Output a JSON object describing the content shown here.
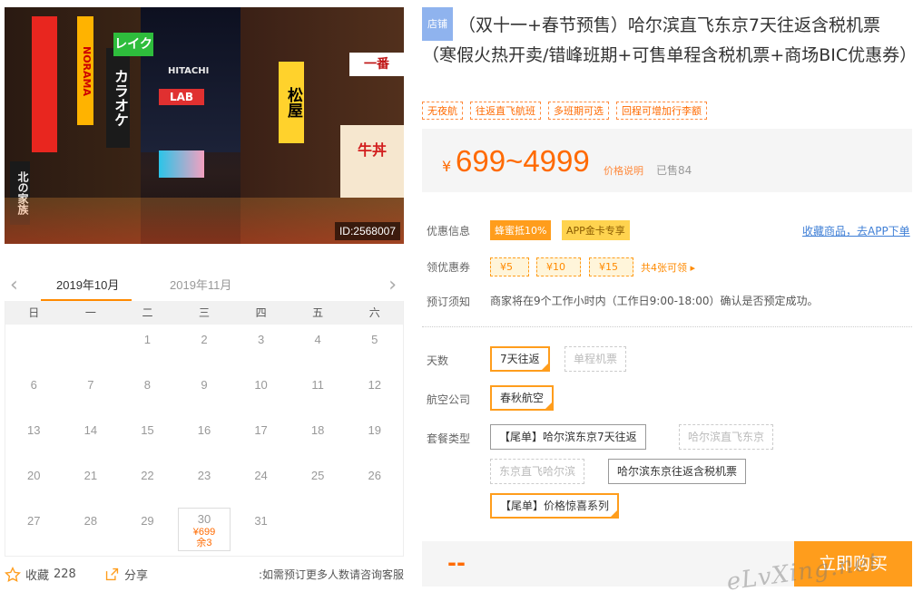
{
  "photo": {
    "id_label": "ID:2568007",
    "signs": [
      "カラオケ",
      "NORAMA",
      "レイク",
      "HITACHI",
      "LAB",
      "松屋",
      "一番",
      "北の家族",
      "牛丼"
    ]
  },
  "calendar": {
    "prev_icon": "chevron-left-icon",
    "next_icon": "chevron-right-icon",
    "months": [
      "2019年10月",
      "2019年11月"
    ],
    "weekdays": [
      "日",
      "一",
      "二",
      "三",
      "四",
      "五",
      "六"
    ],
    "leading_blanks": 2,
    "days": [
      "1",
      "2",
      "3",
      "4",
      "5",
      "6",
      "7",
      "8",
      "9",
      "10",
      "11",
      "12",
      "13",
      "14",
      "15",
      "16",
      "17",
      "18",
      "19",
      "20",
      "21",
      "22",
      "23",
      "24",
      "25",
      "26",
      "27",
      "28",
      "29",
      "30",
      "31"
    ],
    "available": {
      "day": "30",
      "price": "¥699",
      "remaining": "余3"
    }
  },
  "footer": {
    "fav_label": "收藏",
    "fav_count": "228",
    "share_label": "分享",
    "consult_text": ":如需预订更多人数请咨询客服"
  },
  "product": {
    "shop_badge": "店铺",
    "title": "（双十一+春节预售）哈尔滨直飞东京7天往返含税机票（寒假火热开卖/错峰班期+可售单程含税机票+商场BIC优惠券）",
    "tags": [
      "无夜航",
      "往返直飞航班",
      "多班期可选",
      "回程可增加行李额"
    ],
    "price_symbol": "¥",
    "price_range": "699~4999",
    "price_desc": "价格说明",
    "sold": "已售84"
  },
  "offers": {
    "label": "优惠信息",
    "promo1": "蜂蜜抵10%",
    "promo2": "APP金卡专享",
    "fav_app": "收藏商品，去APP下单"
  },
  "coupons": {
    "label": "领优惠券",
    "items": [
      "¥5",
      "¥10",
      "¥15"
    ],
    "more": "共4张可领 ▸"
  },
  "booking": {
    "label": "预订须知",
    "notice": "商家将在9个工作小时内（工作日9:00-18:00）确认是否预定成功。"
  },
  "options": {
    "days_label": "天数",
    "days": [
      {
        "text": "7天往返",
        "state": "selected"
      },
      {
        "text": "单程机票",
        "state": "disabled"
      }
    ],
    "airline_label": "航空公司",
    "airline": [
      {
        "text": "春秋航空",
        "state": "selected"
      }
    ],
    "package_label": "套餐类型",
    "packages": [
      {
        "text": "【尾单】哈尔滨东京7天往返",
        "state": "normal"
      },
      {
        "text": "哈尔滨直飞东京",
        "state": "disabled"
      },
      {
        "text": "东京直飞哈尔滨",
        "state": "disabled"
      },
      {
        "text": "哈尔滨东京往返含税机票",
        "state": "normal"
      },
      {
        "text": "【尾单】价格惊喜系列",
        "state": "selected"
      }
    ]
  },
  "purchase": {
    "total": "--",
    "buy_label": "立即购买",
    "watermark": "eLvXing.net"
  },
  "colors": {
    "accent": "#ff9d1c",
    "price": "#ff6a00",
    "link": "#3f7fd6"
  }
}
